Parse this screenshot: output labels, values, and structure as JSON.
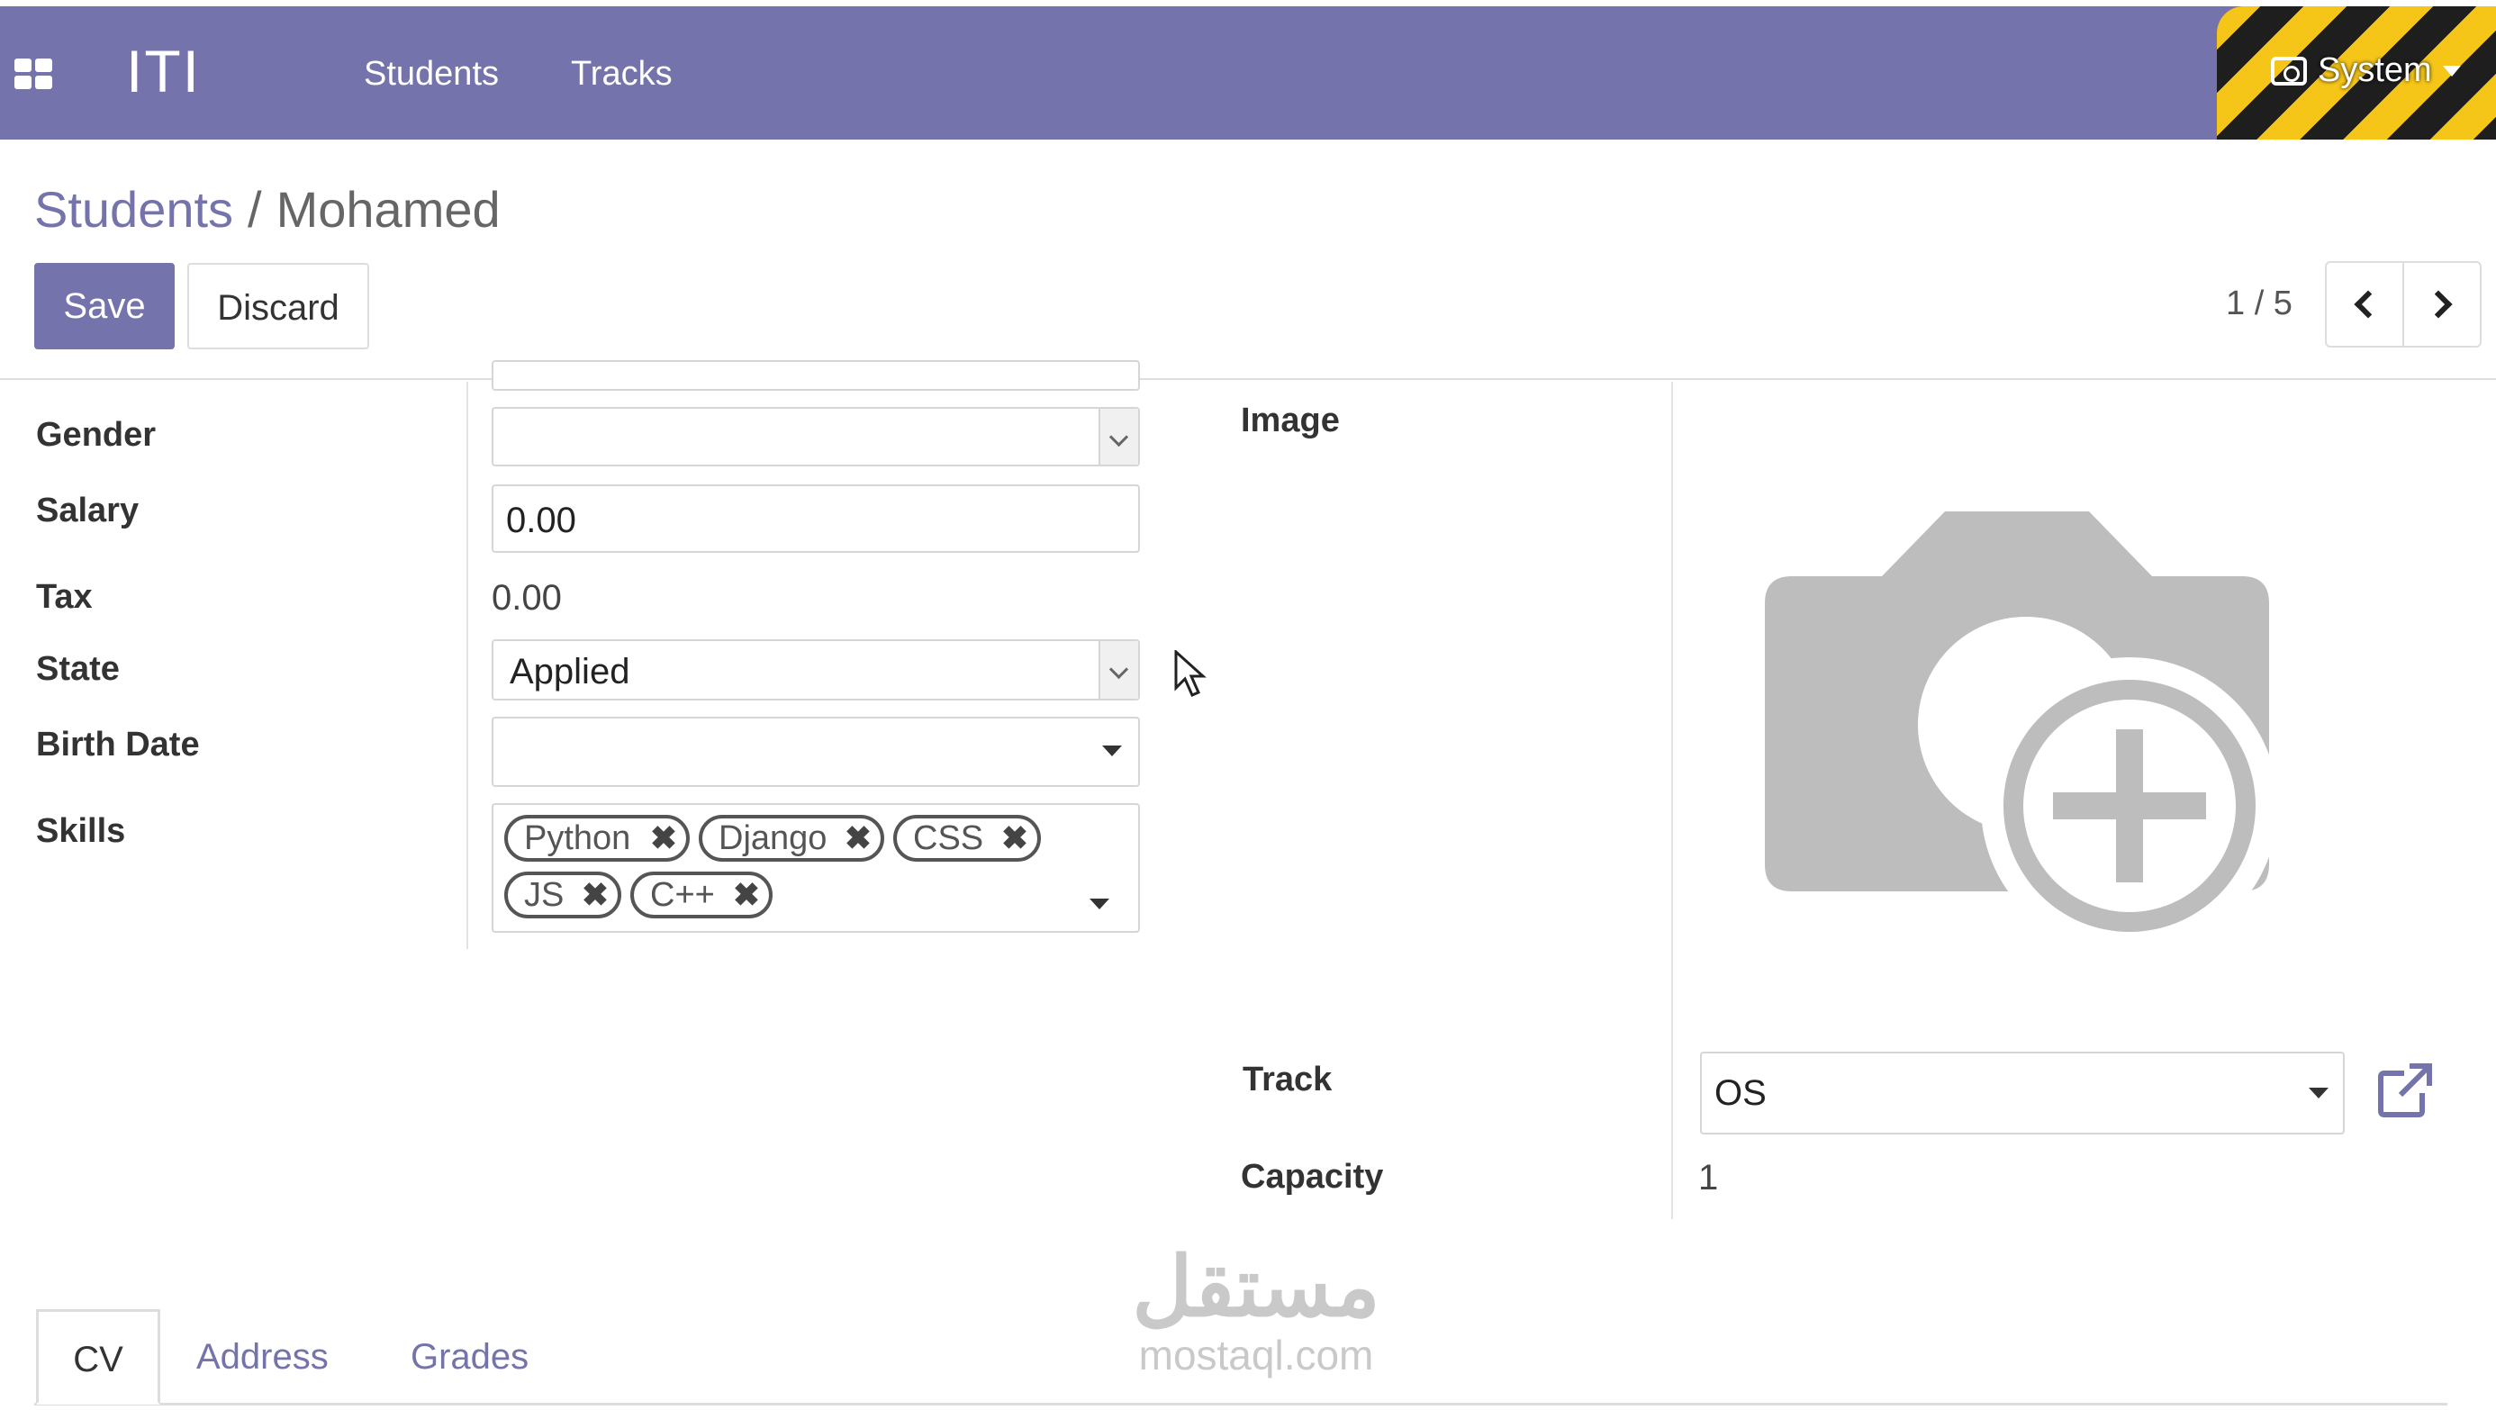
{
  "navbar": {
    "brand": "ITI",
    "menu": [
      "Students",
      "Tracks"
    ],
    "user_menu": "System"
  },
  "breadcrumb": {
    "parent": "Students",
    "separator": "/",
    "current": "Mohamed"
  },
  "actions": {
    "save": "Save",
    "discard": "Discard"
  },
  "pager": {
    "value": "1 / 5"
  },
  "form": {
    "gender": {
      "label": "Gender",
      "value": ""
    },
    "salary": {
      "label": "Salary",
      "value": "0.00"
    },
    "tax": {
      "label": "Tax",
      "value": "0.00"
    },
    "state": {
      "label": "State",
      "value": "Applied"
    },
    "birth_date": {
      "label": "Birth Date",
      "value": ""
    },
    "skills": {
      "label": "Skills",
      "tags": [
        "Python",
        "Django",
        "CSS",
        "JS",
        "C++"
      ]
    },
    "image": {
      "label": "Image"
    },
    "track": {
      "label": "Track",
      "value": "OS"
    },
    "capacity": {
      "label": "Capacity",
      "value": "1"
    }
  },
  "tabs": [
    "CV",
    "Address",
    "Grades"
  ],
  "watermark": {
    "arabic": "مستقل",
    "latin": "mostaql.com"
  },
  "colors": {
    "brand": "#7473ab",
    "hazard_yellow": "#f5c518",
    "hazard_dark": "#1e1e1e"
  }
}
